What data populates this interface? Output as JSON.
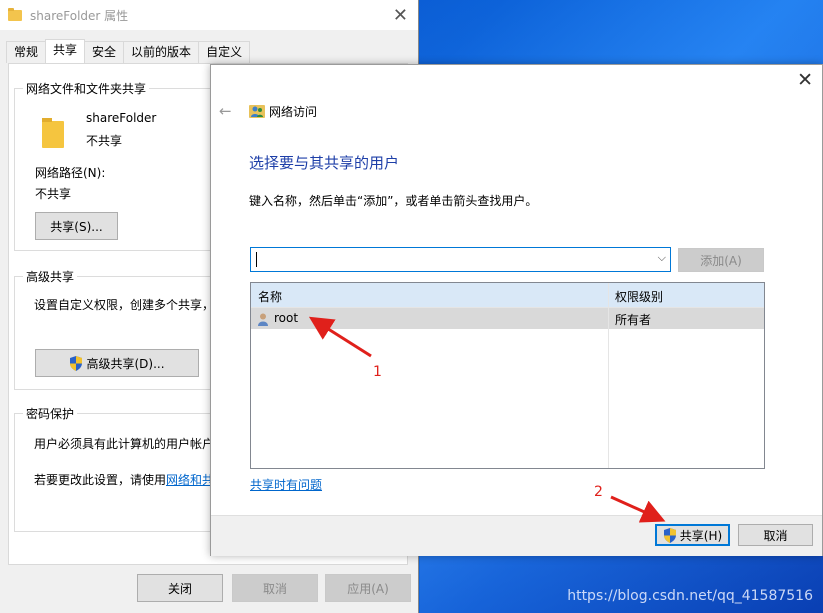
{
  "properties_window": {
    "title": "shareFolder 属性",
    "tabs": [
      "常规",
      "共享",
      "安全",
      "以前的版本",
      "自定义"
    ],
    "network_share_group": {
      "legend": "网络文件和文件夹共享",
      "folder_name": "shareFolder",
      "share_status": "不共享",
      "network_path_label": "网络路径(N):",
      "network_path_value": "不共享",
      "share_button": "共享(S)..."
    },
    "advanced_group": {
      "legend": "高级共享",
      "description": "设置自定义权限，创建多个共享，",
      "button": "高级共享(D)..."
    },
    "password_group": {
      "legend": "密码保护",
      "line1": "用户必须具有此计算机的用户帐户",
      "line2_prefix": "若要更改此设置，请使用",
      "line2_link": "网络和共"
    },
    "buttons": {
      "close": "关闭",
      "cancel": "取消",
      "apply": "应用(A)"
    }
  },
  "network_dialog": {
    "title": "网络访问",
    "heading": "选择要与其共享的用户",
    "instruction": "键入名称，然后单击“添加”，或者单击箭头查找用户。",
    "input_value": "",
    "add_button": "添加(A)",
    "columns": {
      "name": "名称",
      "permission": "权限级别"
    },
    "rows": [
      {
        "name": "root",
        "permission": "所有者"
      }
    ],
    "help_link": "共享时有问题",
    "share_button": "共享(H)",
    "cancel_button": "取消"
  },
  "annotations": {
    "marker1": "1",
    "marker2": "2"
  },
  "watermark": "https://blog.csdn.net/qq_41587516",
  "colors": {
    "accent": "#0078d7",
    "heading": "#1e3fa8",
    "annotation": "#e0201b",
    "link": "#0066cc"
  }
}
